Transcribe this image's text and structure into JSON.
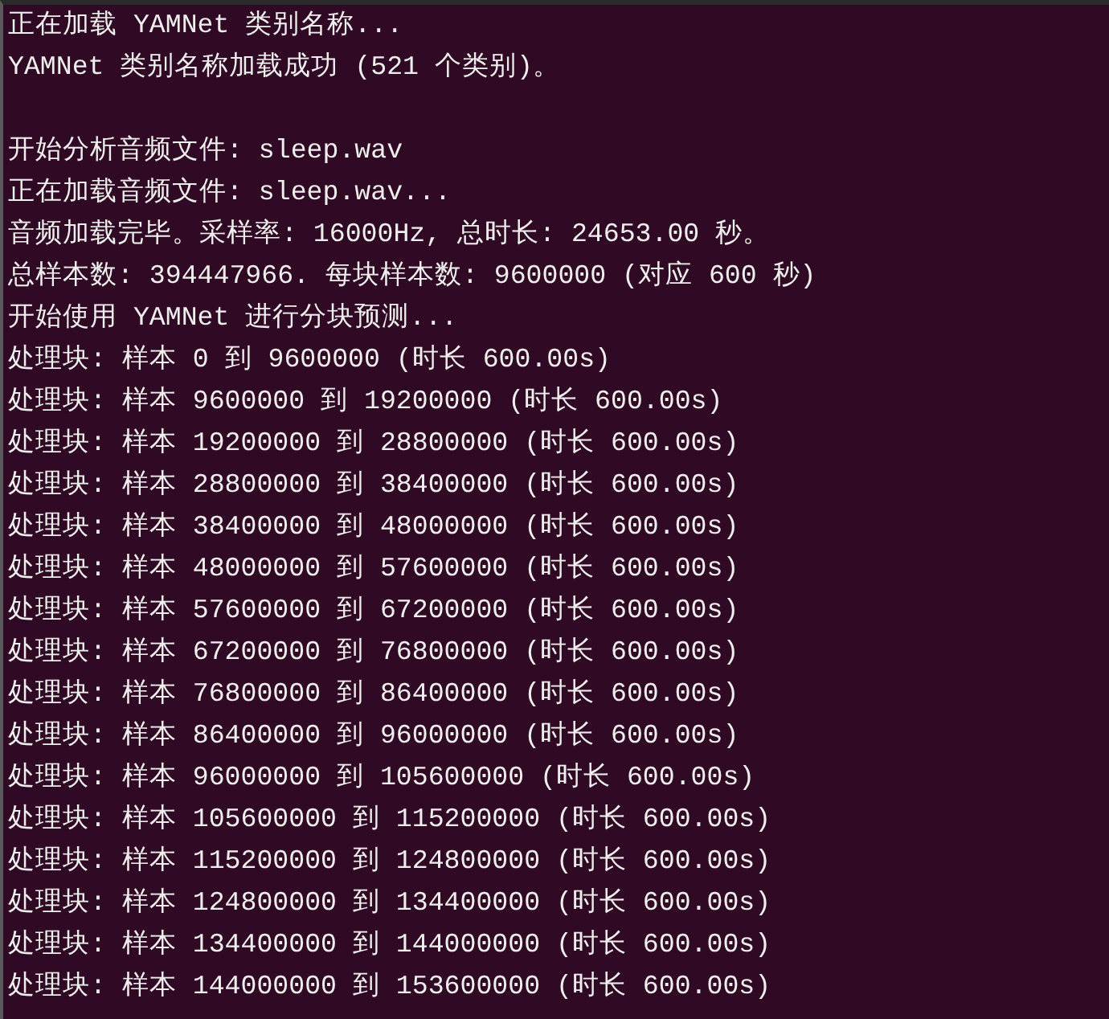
{
  "terminal": {
    "blocks": [
      [
        "正在加载 YAMNet 类别名称...",
        "YAMNet 类别名称加载成功 (521 个类别)。"
      ],
      [
        "开始分析音频文件: sleep.wav",
        "正在加载音频文件: sleep.wav...",
        "音频加载完毕。采样率: 16000Hz, 总时长: 24653.00 秒。",
        "总样本数: 394447966. 每块样本数: 9600000 (对应 600 秒)",
        "开始使用 YAMNet 进行分块预测...",
        "处理块: 样本 0 到 9600000 (时长 600.00s)",
        "处理块: 样本 9600000 到 19200000 (时长 600.00s)",
        "处理块: 样本 19200000 到 28800000 (时长 600.00s)",
        "处理块: 样本 28800000 到 38400000 (时长 600.00s)",
        "处理块: 样本 38400000 到 48000000 (时长 600.00s)",
        "处理块: 样本 48000000 到 57600000 (时长 600.00s)",
        "处理块: 样本 57600000 到 67200000 (时长 600.00s)",
        "处理块: 样本 67200000 到 76800000 (时长 600.00s)",
        "处理块: 样本 76800000 到 86400000 (时长 600.00s)",
        "处理块: 样本 86400000 到 96000000 (时长 600.00s)",
        "处理块: 样本 96000000 到 105600000 (时长 600.00s)",
        "处理块: 样本 105600000 到 115200000 (时长 600.00s)",
        "处理块: 样本 115200000 到 124800000 (时长 600.00s)",
        "处理块: 样本 124800000 到 134400000 (时长 600.00s)",
        "处理块: 样本 134400000 到 144000000 (时长 600.00s)",
        "处理块: 样本 144000000 到 153600000 (时长 600.00s)"
      ]
    ]
  }
}
